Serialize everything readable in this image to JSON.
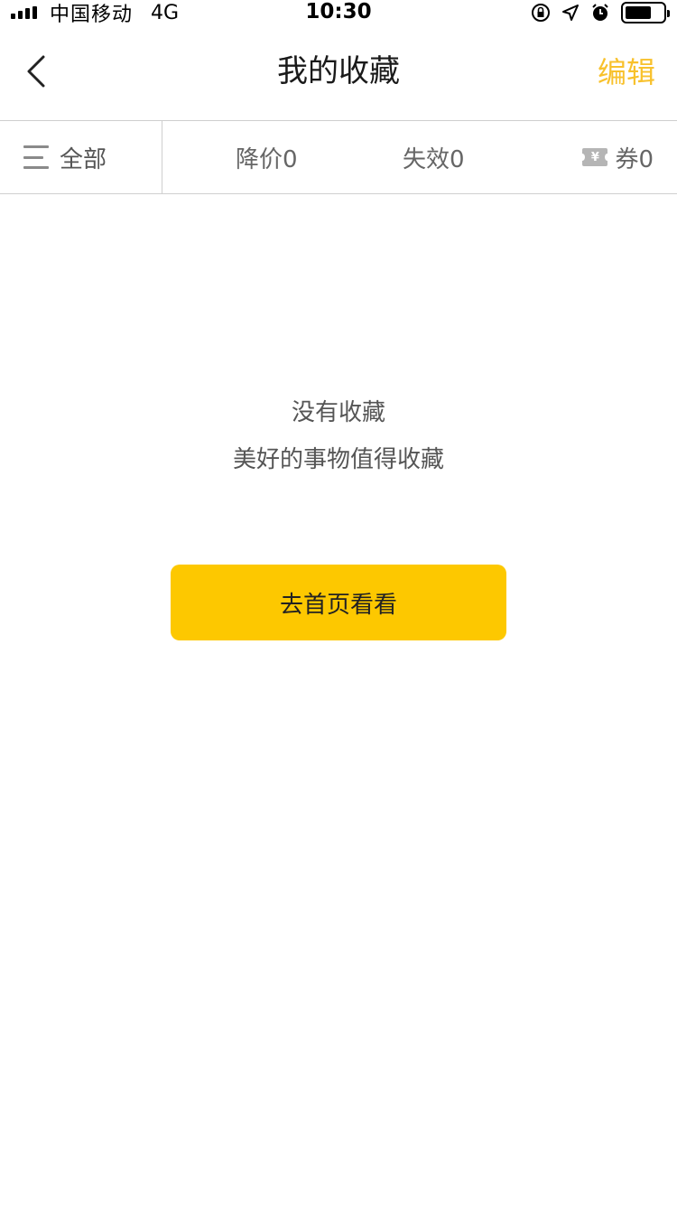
{
  "status_bar": {
    "carrier": "中国移动",
    "network": "4G",
    "time": "10:30",
    "battery_level": 0.7,
    "icons": [
      "signal-icon",
      "rotation-lock-icon",
      "location-icon",
      "alarm-icon",
      "battery-icon"
    ]
  },
  "nav": {
    "back_icon": "chevron-left-icon",
    "title": "我的收藏",
    "edit_label": "编辑"
  },
  "filters": {
    "all_label": "全部",
    "all_icon": "menu-icon",
    "price_drop_label": "降价0",
    "invalid_label": "失效0",
    "coupon_icon": "coupon-icon",
    "coupon_label": "券0"
  },
  "empty_state": {
    "title": "没有收藏",
    "subtitle": "美好的事物值得收藏",
    "button_label": "去首页看看"
  },
  "colors": {
    "accent": "#f8c12c",
    "button_bg": "#fdc800",
    "divider": "#cfcfcf"
  }
}
